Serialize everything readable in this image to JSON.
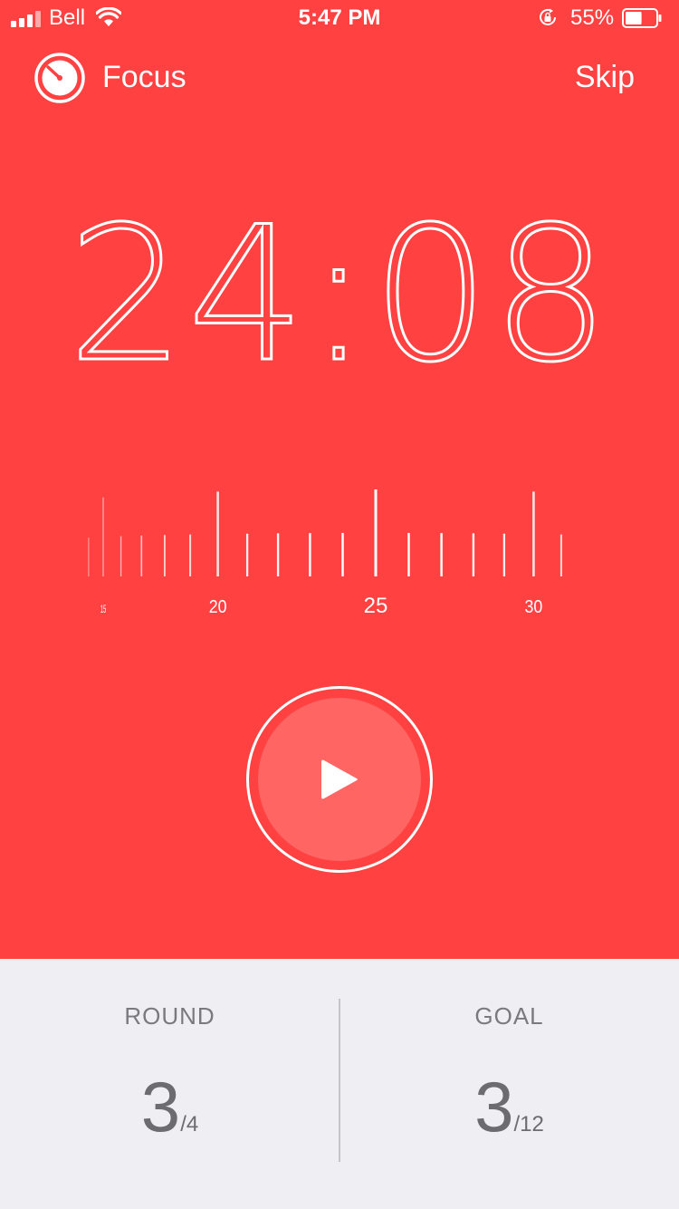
{
  "status_bar": {
    "carrier": "Bell",
    "time": "5:47 PM",
    "battery": "55%",
    "battery_level": 0.55
  },
  "header": {
    "title": "Focus",
    "skip_label": "Skip"
  },
  "timer": {
    "minutes": "24",
    "seconds": "08"
  },
  "ruler": {
    "labels": [
      "15",
      "20",
      "25",
      "30"
    ],
    "current_value": 25
  },
  "controls": {
    "play_icon": "play-icon"
  },
  "stats": {
    "round_label": "ROUND",
    "round_value": "3",
    "round_total": "/4",
    "goal_label": "GOAL",
    "goal_value": "3",
    "goal_total": "/12"
  },
  "colors": {
    "accent": "#FF4141",
    "panel": "#EFEEF3"
  }
}
